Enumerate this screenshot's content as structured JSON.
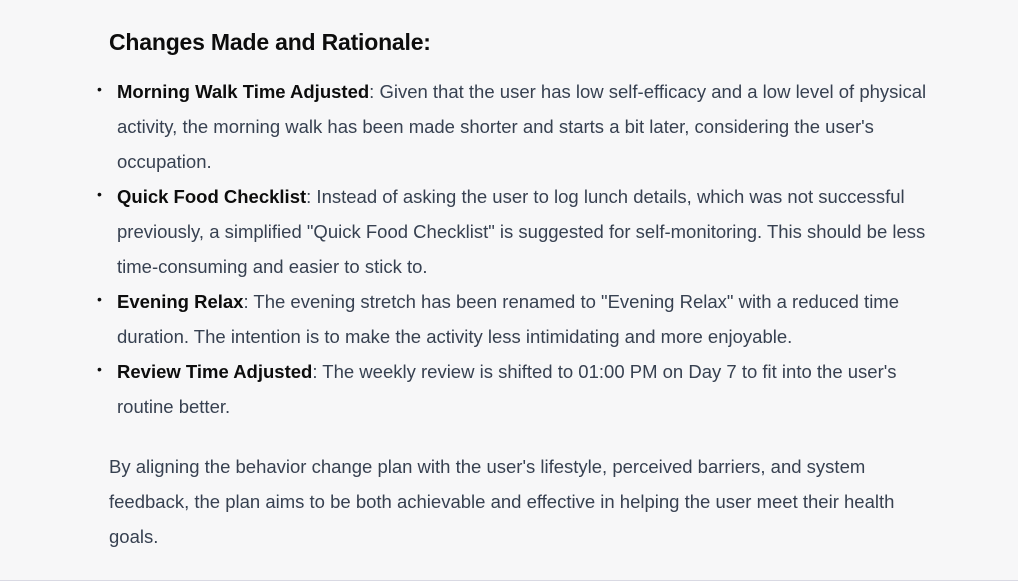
{
  "heading": "Changes Made and Rationale:",
  "changes": [
    {
      "term": "Morning Walk Time Adjusted",
      "text": ": Given that the user has low self-efficacy and a low level of physical activity, the morning walk has been made shorter and starts a bit later, considering the user's occupation."
    },
    {
      "term": "Quick Food Checklist",
      "text": ": Instead of asking the user to log lunch details, which was not successful previously, a simplified \"Quick Food Checklist\" is suggested for self-monitoring. This should be less time-consuming and easier to stick to."
    },
    {
      "term": "Evening Relax",
      "text": ": The evening stretch has been renamed to \"Evening Relax\" with a reduced time duration. The intention is to make the activity less intimidating and more enjoyable."
    },
    {
      "term": "Review Time Adjusted",
      "text": ": The weekly review is shifted to 01:00 PM on Day 7 to fit into the user's routine better."
    }
  ],
  "summary": "By aligning the behavior change plan with the user's lifestyle, perceived barriers, and system feedback, the plan aims to be both achievable and effective in helping the user meet their health goals."
}
